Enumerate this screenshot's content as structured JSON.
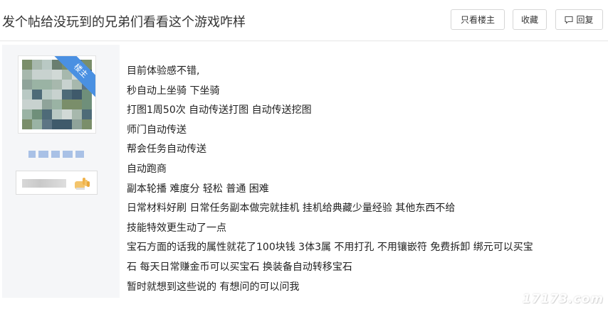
{
  "thread": {
    "title": "发个帖给没玩到的兄弟们看看这个游戏咋样"
  },
  "actions": {
    "only_op_label": "只看楼主",
    "favorite_label": "收藏",
    "reply_label": "回复"
  },
  "author": {
    "op_ribbon": "楼主",
    "avatar": "pixelated-avatar",
    "username": "",
    "badge_icon": "hand-icon"
  },
  "post": {
    "lines": [
      "目前体验感不错,",
      "秒自动上坐骑 下坐骑",
      "打图1周50次 自动传送打图 自动传送挖图",
      "师门自动传送",
      "帮会任务自动传送",
      "自动跑商",
      "副本轮播 难度分 轻松 普通 困难",
      "日常材料好刷 日常任务副本做完就挂机 挂机给典藏少量经验 其他东西不给",
      "技能特效更生动了一点",
      "宝石方面的话我的属性就花了100块钱 3体3属 不用打孔 不用镶嵌符 免费拆卸 绑元可以买宝",
      "石 每天日常赚金币可以买宝石 换装备自动转移宝石",
      "暂时就想到这些说的 有想问的可以问我"
    ]
  },
  "watermark": "17173.com",
  "colors": {
    "ribbon": "#4a90e2",
    "sidebar_bg": "#f5f6f8",
    "border": "#d6d6d6"
  }
}
